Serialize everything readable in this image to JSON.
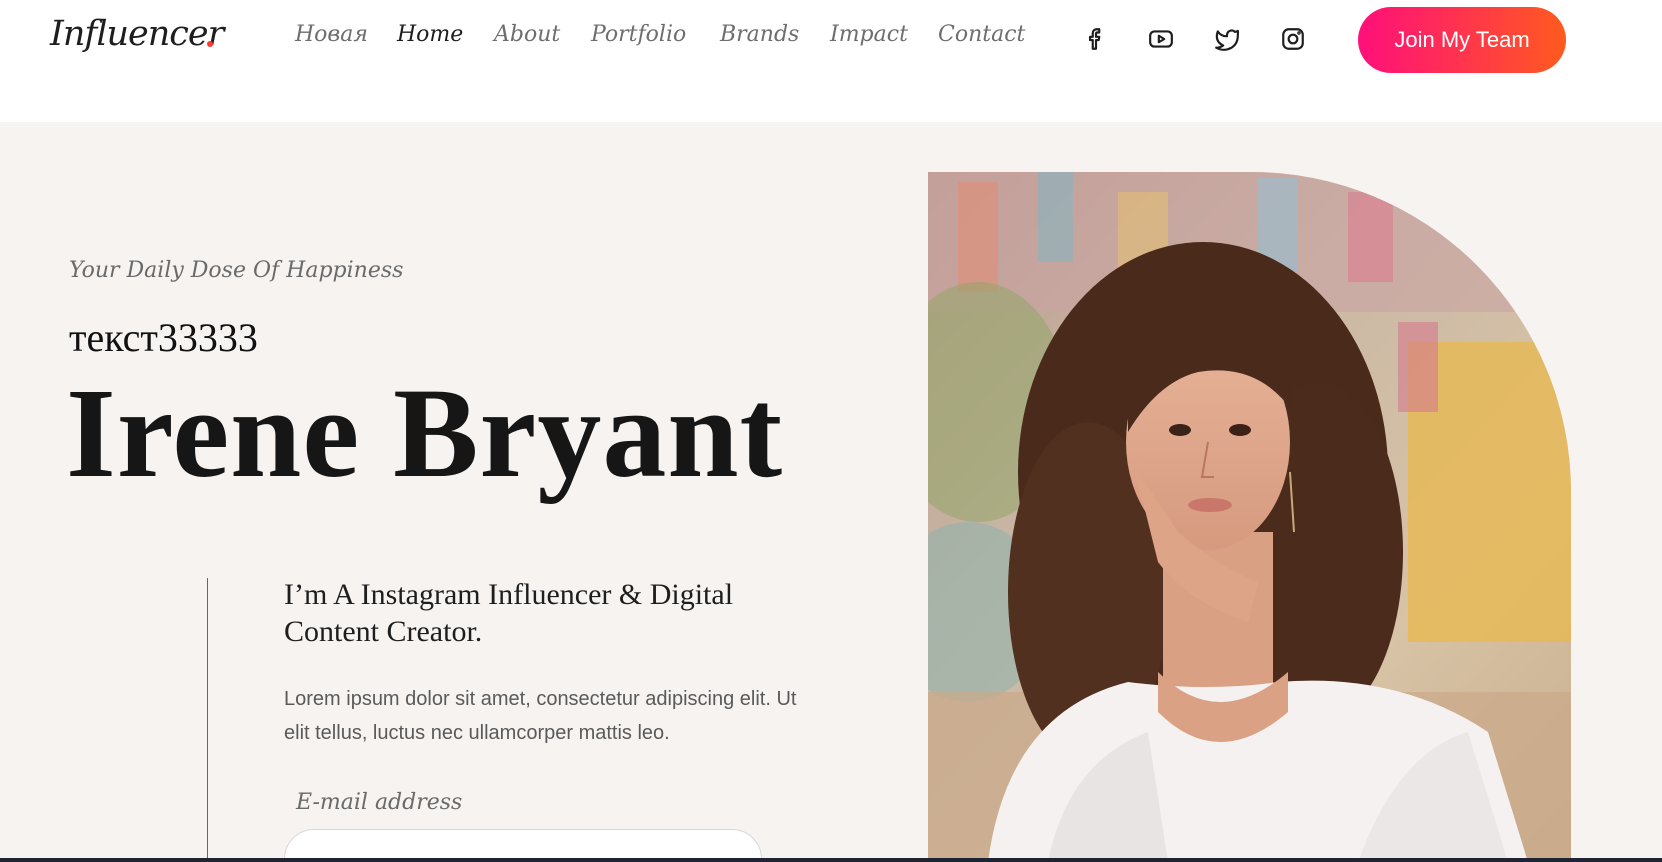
{
  "header": {
    "logo": "Influencer",
    "nav": [
      {
        "label": "Новая",
        "active": false
      },
      {
        "label": "Home",
        "active": true
      },
      {
        "label": "About",
        "active": false
      },
      {
        "label": "Portfolio",
        "active": false
      },
      {
        "label": "Brands",
        "active": false
      },
      {
        "label": "Impact",
        "active": false
      },
      {
        "label": "Contact",
        "active": false
      }
    ],
    "social_icons": [
      "facebook-icon",
      "youtube-icon",
      "twitter-icon",
      "instagram-icon"
    ],
    "join_button": "Join My Team"
  },
  "hero": {
    "tagline": "Your Daily Dose Of Happiness",
    "subtitle": "текст33333",
    "name": "Irene Bryant",
    "intro": "I’m A Instagram Influencer & Digital Content Creator.",
    "description": "Lorem ipsum dolor sit amet, consectetur adipiscing elit. Ut elit tellus, luctus nec ullamcorper mattis leo.",
    "email_label": "E-mail address",
    "email_value": "",
    "email_placeholder": ""
  },
  "colors": {
    "accent": "#ff3b30",
    "button_gradient_start": "#ff0f7b",
    "button_gradient_end": "#ff5a1f",
    "hero_background": "#f6f3f1",
    "accent_line": "#c2452d"
  }
}
